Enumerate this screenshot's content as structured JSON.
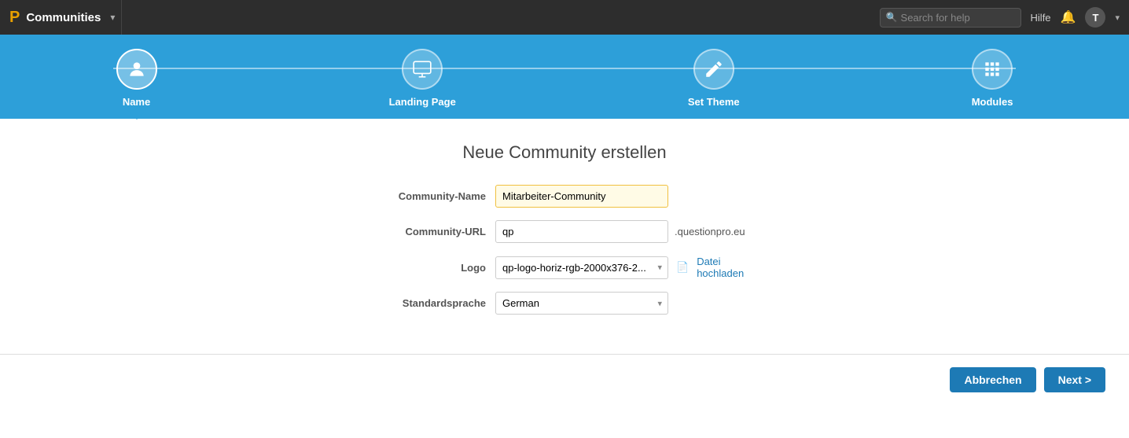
{
  "topNav": {
    "logoIcon": "P",
    "appName": "Communities",
    "searchPlaceholder": "Search for help",
    "helpLabel": "Hilfe",
    "userInitial": "T"
  },
  "wizard": {
    "steps": [
      {
        "id": "name",
        "label": "Name",
        "icon": "👤",
        "active": true
      },
      {
        "id": "landing-page",
        "label": "Landing Page",
        "icon": "🖥",
        "active": false
      },
      {
        "id": "set-theme",
        "label": "Set Theme",
        "icon": "✏️",
        "active": false
      },
      {
        "id": "modules",
        "label": "Modules",
        "icon": "⚙",
        "active": false
      }
    ]
  },
  "form": {
    "title": "Neue Community erstellen",
    "fields": {
      "communityNameLabel": "Community-Name",
      "communityNameValue": "Mitarbeiter-Community",
      "communityUrlLabel": "Community-URL",
      "communityUrlValue": "qp",
      "communityUrlSuffix": ".questionpro.eu",
      "logoLabel": "Logo",
      "logoValue": "qp-logo-horiz-rgb-2000x376-2....",
      "uploadLabel": "Datei hochladen",
      "standardspracheLabel": "Standardsprache",
      "standardspracheValue": "German"
    }
  },
  "footer": {
    "cancelLabel": "Abbrechen",
    "nextLabel": "Next >"
  }
}
